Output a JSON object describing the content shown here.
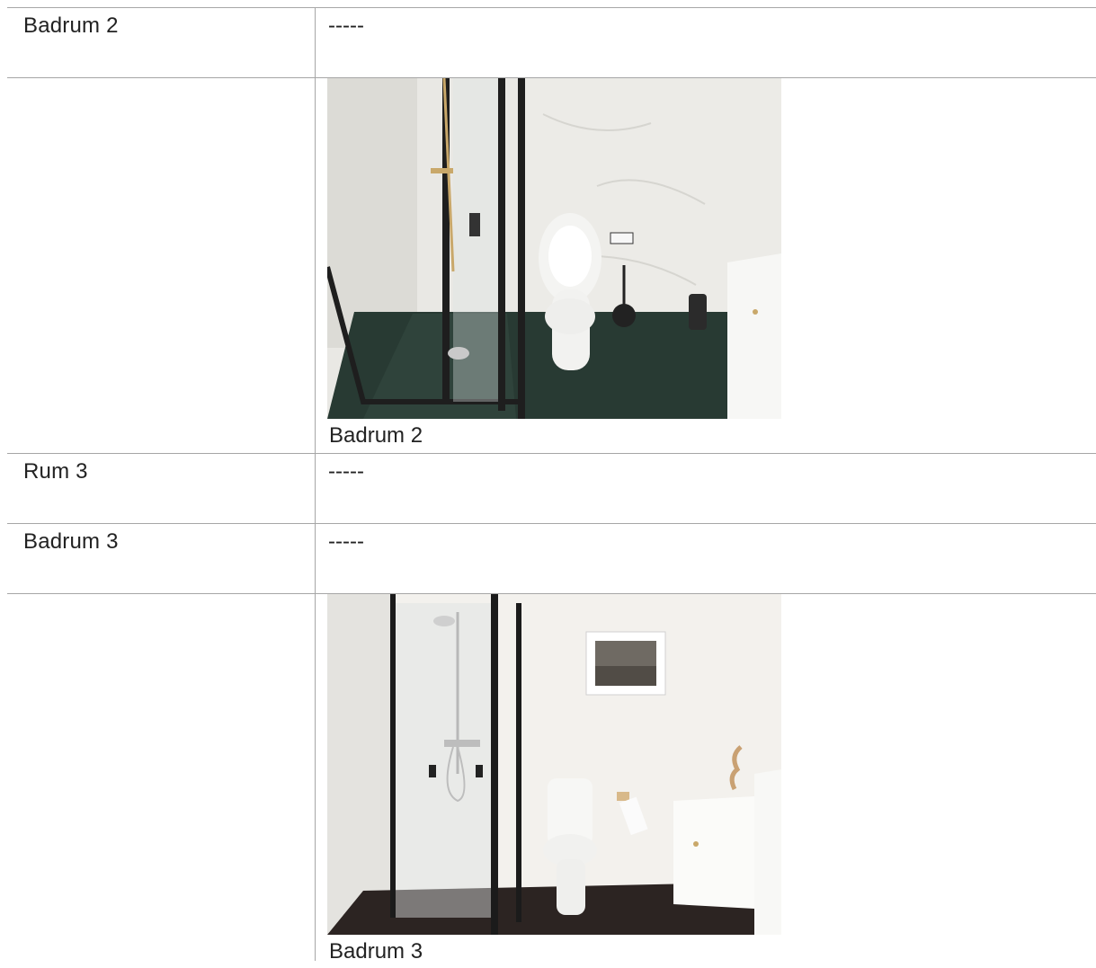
{
  "rows": [
    {
      "label": "Badrum 2",
      "value": "-----"
    },
    {
      "label": "",
      "caption": "Badrum 2"
    },
    {
      "label": "Rum 3",
      "value": "-----"
    },
    {
      "label": "Badrum 3",
      "value": "-----"
    },
    {
      "label": "",
      "caption": "Badrum 3"
    }
  ],
  "colors": {
    "border": "#a6a6a6",
    "text": "#222222"
  }
}
